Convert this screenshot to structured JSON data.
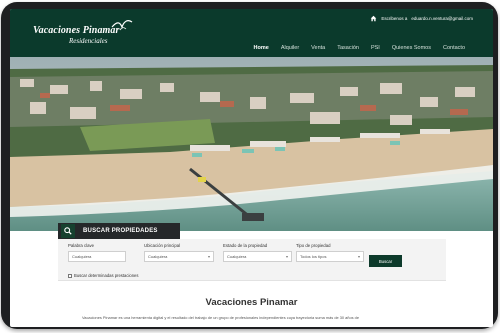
{
  "site": {
    "logo_main": "Vacaciones Pinamar",
    "logo_sub": "Residenciales"
  },
  "header": {
    "contact_label": "Escribenos a",
    "contact_email": "eduardo.n.ventura@gmail.com",
    "nav": [
      {
        "label": "Home",
        "active": true
      },
      {
        "label": "Alquiler"
      },
      {
        "label": "Venta"
      },
      {
        "label": "Tasación"
      },
      {
        "label": "PSI"
      },
      {
        "label": "Quienes Somos"
      },
      {
        "label": "Contacto"
      }
    ]
  },
  "search": {
    "title": "BUSCAR PROPIEDADES",
    "fields": [
      {
        "label": "Palabra clave",
        "value": "Cualquiera"
      },
      {
        "label": "Ubicación principal",
        "value": "Cualquiera"
      },
      {
        "label": "Estado de la propiedad",
        "value": "Cualquiera"
      },
      {
        "label": "Tipo de propiedad",
        "value": "Todos los tipos"
      }
    ],
    "button": "Buscar",
    "checkbox_label": "Buscar determinadas prestaciones"
  },
  "main": {
    "title": "Vacaciones Pinamar",
    "intro": "Vacaciones Pinamar es una herramienta digital y el resultado del trabajo de un grupo de profesionales independientes cuya trayectoria suma más de 30 años de"
  },
  "colors": {
    "header_bg": "#0b3a2c",
    "button_bg": "#0d3a2b",
    "tablet_frame": "#1e1f21"
  },
  "icons": {
    "contact": "home-icon",
    "search": "search-icon",
    "logo": "seagull-icon"
  }
}
